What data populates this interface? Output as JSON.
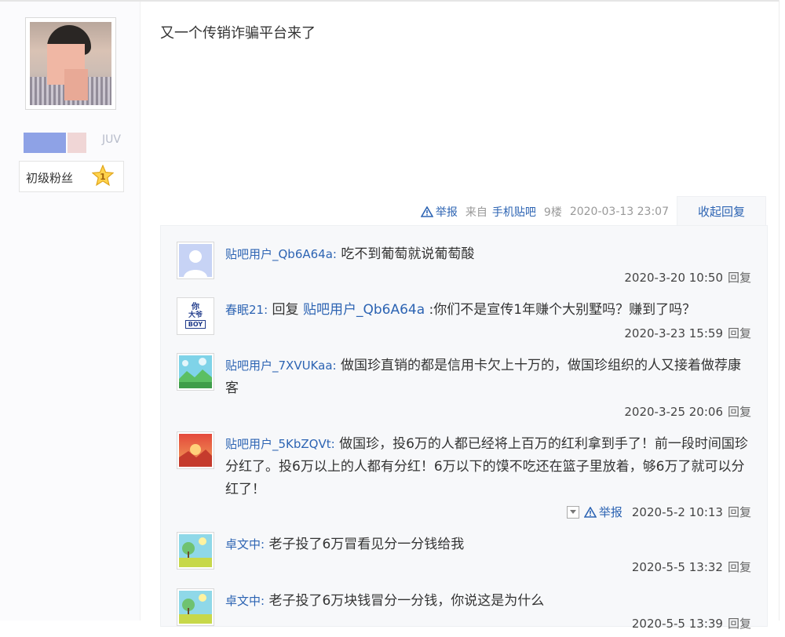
{
  "author": {
    "name_suffix": "JUV",
    "level_label": "初级粉丝",
    "level_number": "1"
  },
  "post": {
    "content": "又一个传销诈骗平台来了",
    "report_label": "举报",
    "from_label": "来自",
    "from_link": "手机贴吧",
    "floor": "9楼",
    "time": "2020-03-13 23:07",
    "fold_label": "收起回复"
  },
  "replies": [
    {
      "user": "贴吧用户_Qb6A64a:",
      "content": " 吃不到葡萄就说葡萄酸",
      "time": "2020-3-20 10:50",
      "reply_label": "回复",
      "avatar": "default-person-avatar"
    },
    {
      "user": "春眠21:",
      "reply_prefix": " 回复 ",
      "reply_to": "贴吧用户_Qb6A64a",
      "content": " :你们不是宣传1年赚个大别墅吗？赚到了吗？",
      "time": "2020-3-23 15:59",
      "reply_label": "回复",
      "avatar_text_top": "你",
      "avatar_text_mid": "大爷",
      "avatar_text_bot": "BOY"
    },
    {
      "user": "贴吧用户_7XVUKaa:",
      "content": " 做国珍直销的都是信用卡欠上十万的，做国珍组织的人又接着做荐康客",
      "time": "2020-3-25 20:06",
      "reply_label": "回复",
      "avatar": "landscape-avatar"
    },
    {
      "user": "贴吧用户_5KbZQVt:",
      "content": " 做国珍，投6万的人都已经将上百万的红利拿到手了！前一段时间国珍分红了。投6万以上的人都有分红！6万以下的馍不吃还在篮子里放着，够6万了就可以分红了！",
      "time": "2020-5-2 10:13",
      "reply_label": "回复",
      "report_label": "举报",
      "avatar": "sunset-avatar"
    },
    {
      "user": "卓文中:",
      "content": " 老子投了6万冒看见分一分钱给我",
      "time": "2020-5-5 13:32",
      "reply_label": "回复",
      "avatar": "tree-avatar"
    },
    {
      "user": "卓文中:",
      "content": " 老子投了6万块钱冒分一分钱，你说这是为什么",
      "time": "2020-5-5 13:39",
      "reply_label": "回复",
      "avatar": "tree-avatar"
    }
  ],
  "colors": {
    "link": "#2d64b3",
    "panel_bg": "#f7f8fa",
    "text": "#333333",
    "muted": "#999999"
  }
}
